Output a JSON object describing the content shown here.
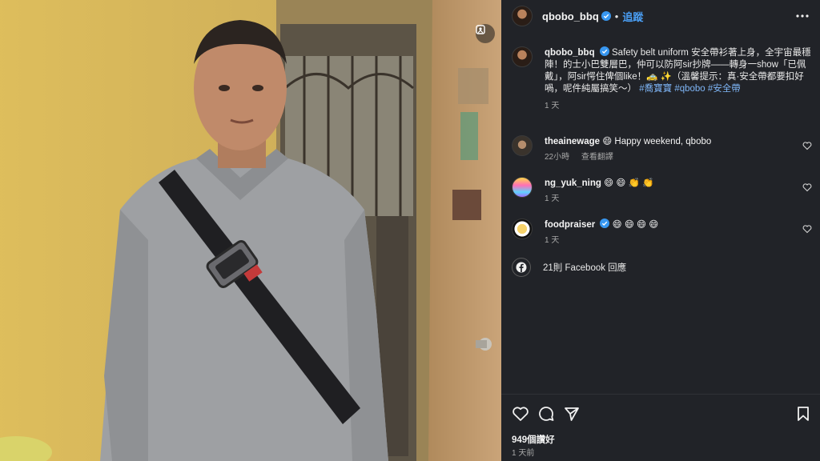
{
  "post": {
    "username": "qbobo_bbq",
    "follow_label": "追蹤",
    "separator": "•",
    "caption_username": "qbobo_bbq",
    "caption_text": "Safety belt uniform 安全帶衫著上身，全宇宙最穩陣！的士小巴雙層巴，仲可以防阿sir抄牌——轉身一show「已佩戴」，阿sir愕住俾個like！🚕 ✨（溫馨提示：真·安全帶都要扣好喎，呢件純屬搞笑～）",
    "hashtags": [
      "#喬寶寶",
      "#qbobo",
      "#安全帶"
    ],
    "caption_time": "1 天",
    "like_count_text": "949個讚好",
    "posted_ago": "1 天前"
  },
  "comments": [
    {
      "username": "theainewage",
      "text": "😄 Happy weekend, qbobo",
      "time": "22小時",
      "translate_label": "查看翻譯"
    },
    {
      "username": "ng_yuk_ning",
      "text": "😄 😄 👏 👏",
      "time": "1 天"
    },
    {
      "username": "foodpraiser",
      "text": "😄 😄 😄 😄",
      "time": "1 天"
    }
  ],
  "facebook_replies_label": "21則 Facebook 回應",
  "icons": {
    "more": "more-horizontal-icon",
    "verified": "verified-badge-icon",
    "like": "heart-icon",
    "comment": "comment-bubble-icon",
    "share": "paper-plane-icon",
    "save": "bookmark-icon",
    "facebook": "facebook-icon",
    "media_tag": "tagged-media-icon"
  },
  "colors": {
    "panel_bg": "#212328",
    "link_blue": "#4a9ff5",
    "verified_blue": "#3897f0",
    "wall_yellow": "#d9b752"
  }
}
